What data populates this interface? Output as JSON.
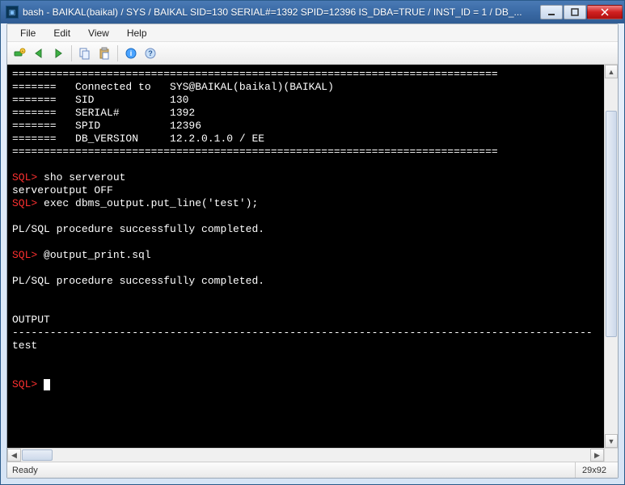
{
  "title": "bash - BAIKAL(baikal) / SYS / BAIKAL   SID=130   SERIAL#=1392   SPID=12396   IS_DBA=TRUE / INST_ID = 1 / DB_...",
  "menu": {
    "file": "File",
    "edit": "Edit",
    "view": "View",
    "help": "Help"
  },
  "status": {
    "ready": "Ready",
    "dim": "29x92"
  },
  "term": {
    "rule": "=============================================================================",
    "c_label": "=======   Connected to   SYS@BAIKAL(baikal)(BAIKAL)",
    "sid": "=======   SID            130",
    "serial": "=======   SERIAL#        1392",
    "spid": "=======   SPID           12396",
    "dbver": "=======   DB_VERSION     12.2.0.1.0 / EE",
    "prompt": "SQL>",
    "cmd1": " sho serverout",
    "out1": "serveroutput OFF",
    "cmd2": " exec dbms_output.put_line('test');",
    "plsql": "PL/SQL procedure successfully completed.",
    "cmd3": " @output_print.sql",
    "outhdr": "OUTPUT",
    "dash": "--------------------------------------------------------------------------------------------",
    "outval": "test"
  }
}
